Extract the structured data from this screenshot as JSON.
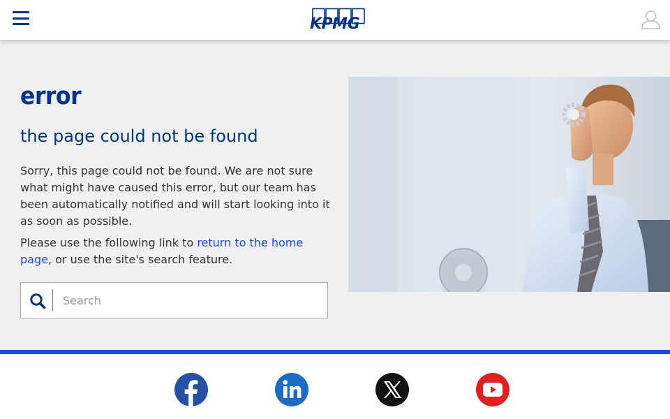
{
  "header": {
    "menu_icon": "hamburger-menu-icon",
    "logo_text": "KPMG",
    "user_icon": "user-icon",
    "brand_color": "#00338d"
  },
  "main": {
    "title": "error",
    "subtitle": "the page could not be found",
    "message": "Sorry, this page could not be found. We are not sure what might have caused this error, but our team has been automatically notified and will start looking into it as soon as possible.",
    "help_prefix": "Please use the following link to ",
    "home_link_text": "return to the home page",
    "help_suffix": ", or use the site's search feature.",
    "search": {
      "placeholder": "Search",
      "value": "",
      "icon": "search-icon"
    },
    "hero_image": "man-looking-through-gear-photo"
  },
  "footer": {
    "accent_color": "#1e49e2",
    "social": [
      {
        "name": "facebook",
        "icon": "facebook-icon",
        "color": "#2450a6"
      },
      {
        "name": "linkedin",
        "icon": "linkedin-icon",
        "color": "#1d6cc4"
      },
      {
        "name": "x",
        "icon": "x-twitter-icon",
        "color": "#111111"
      },
      {
        "name": "youtube",
        "icon": "youtube-icon",
        "color": "#e01f1f"
      }
    ]
  }
}
